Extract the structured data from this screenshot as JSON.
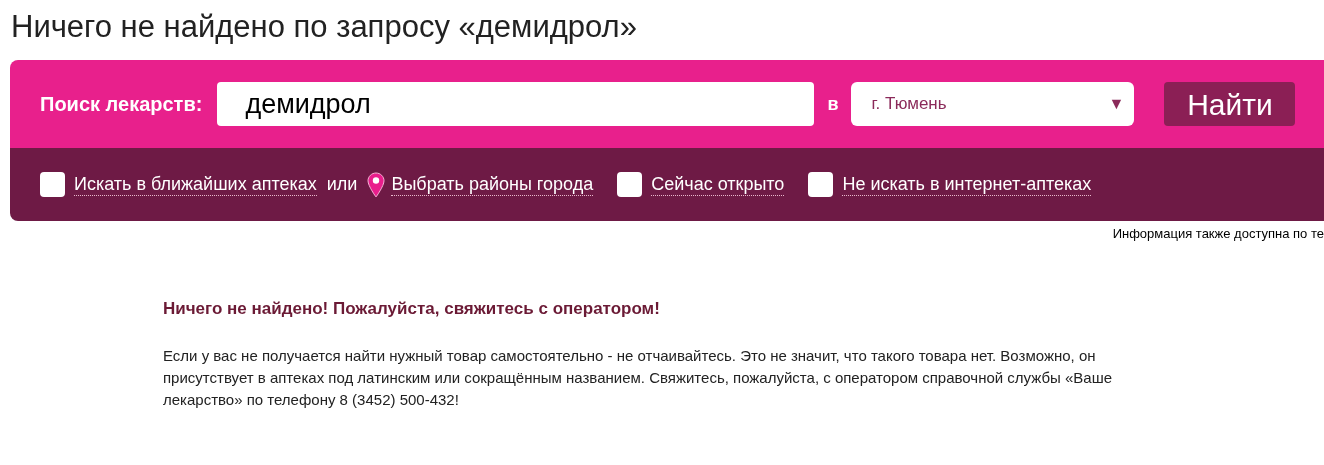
{
  "heading": "Ничего не найдено по запросу «демидрол»",
  "search": {
    "label": "Поиск лекарств:",
    "value": "демидрол",
    "in_label": "в",
    "city": "г. Тюмень",
    "dropdown_arrow": "▼",
    "button": "Найти"
  },
  "filters": [
    {
      "kind": "checkbox",
      "label": "Искать в ближайших аптеках",
      "checked": false
    },
    {
      "kind": "text",
      "label": "или"
    },
    {
      "kind": "location_link",
      "label": "Выбрать районы города"
    },
    {
      "kind": "checkbox",
      "label": "Сейчас открыто",
      "checked": false
    },
    {
      "kind": "checkbox",
      "label": "Не искать в интернет-аптеках",
      "checked": false
    }
  ],
  "info_note": "Информация также доступна по те",
  "message": {
    "title": "Ничего не найдено! Пожалуйста, свяжитесь с оператором!",
    "body": "Если у вас не получается найти нужный товар самостоятельно - не отчаивайтесь. Это не значит, что такого товара нет. Возможно, он присутствует в аптеках под латинским или сокращённым названием. Свяжитесь, пожалуйста, с оператором справочной службы «Ваше лекарство» по телефону 8 (3452) 500-432!"
  }
}
